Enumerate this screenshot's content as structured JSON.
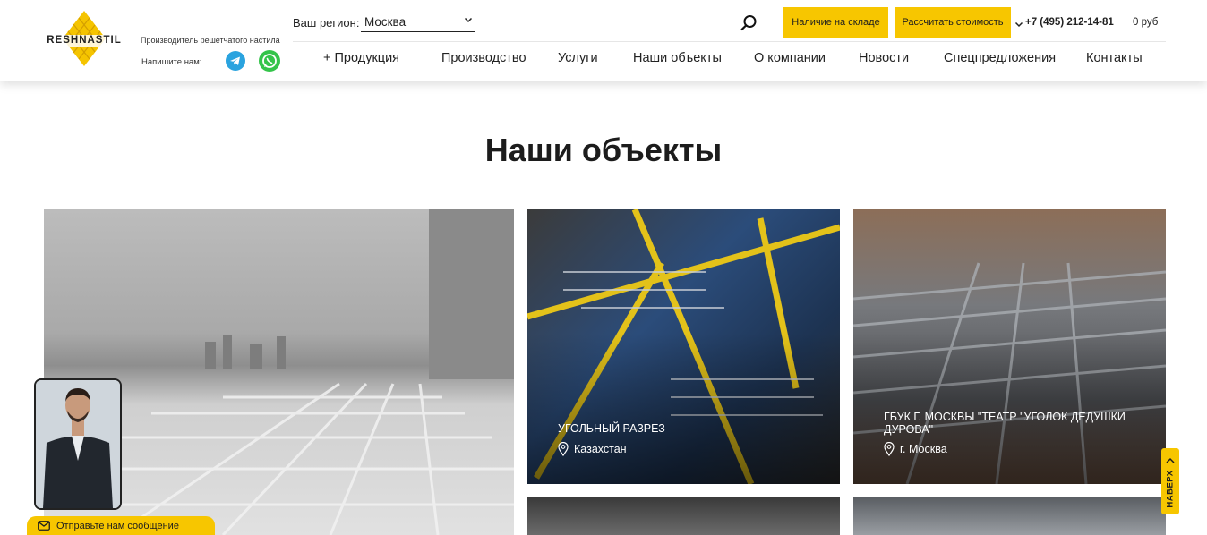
{
  "header": {
    "logo_text": "RESHNASTIL",
    "tagline": "Производитель решетчатого настила",
    "write_us_label": "Напишите нам:",
    "region_label": "Ваш регион:",
    "region_value": "Москва",
    "stock_button": "Наличие на складе",
    "calc_button": "Рассчитать стоимость",
    "phone": "+7 (495) 212-14-81",
    "cart": "0 руб"
  },
  "nav": {
    "items": [
      "+ Продукция",
      "Производство",
      "Услуги",
      "Наши объекты",
      "О компании",
      "Новости",
      "Спецпредложения",
      "Контакты"
    ]
  },
  "main": {
    "title": "Наши объекты",
    "cards": [
      {
        "title": "Угольный разрез",
        "location": "Казахстан"
      },
      {
        "title": "ГБУК г. Москвы \"Театр \"Уголок дедушки Дурова\"",
        "location": "г. Москва"
      }
    ]
  },
  "widgets": {
    "message_label": "Отправьте нам сообщение",
    "to_top_label": "НАВЕРХ"
  },
  "colors": {
    "accent": "#f7c600",
    "telegram": "#2aa3df",
    "whatsapp": "#34c44a"
  }
}
